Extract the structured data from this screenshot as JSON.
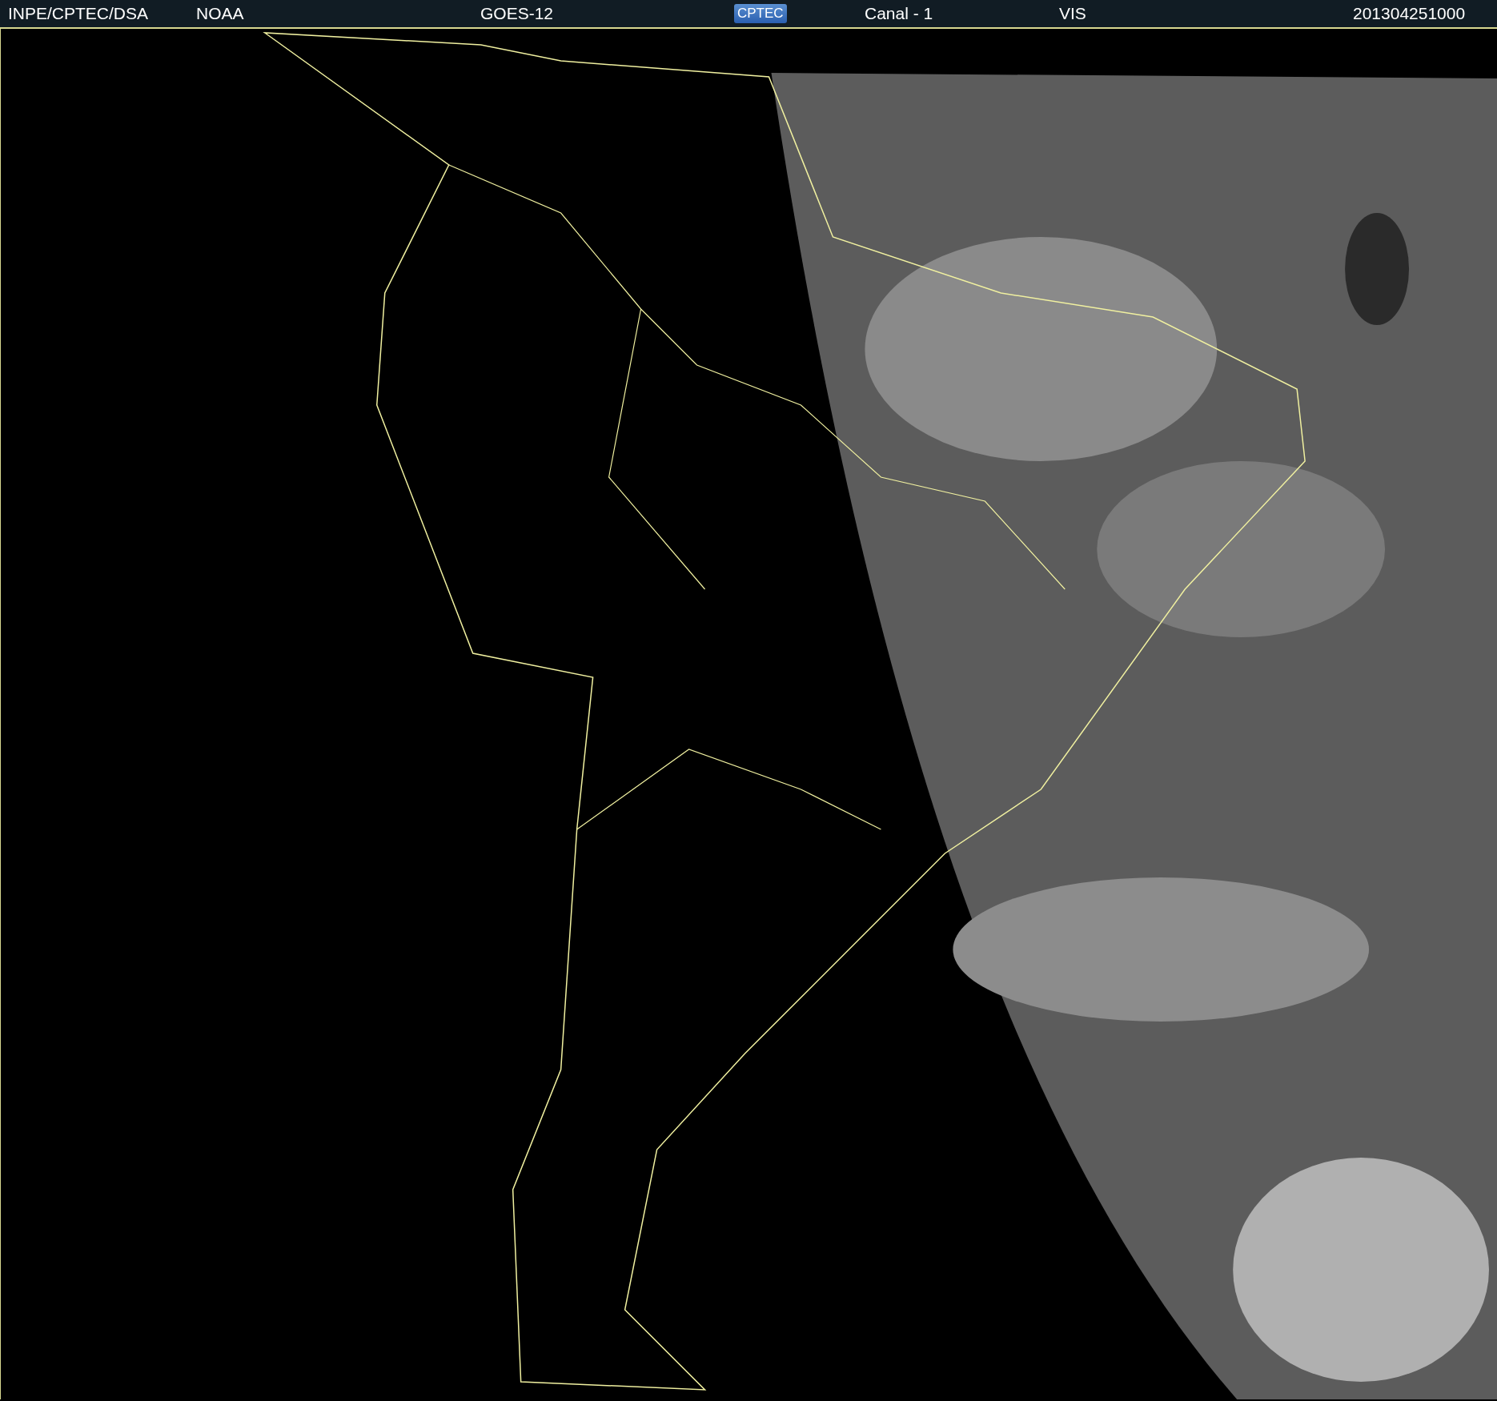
{
  "header": {
    "agency": "INPE/CPTEC/DSA",
    "source": "NOAA",
    "satellite": "GOES-12",
    "logo": "CPTEC",
    "channel": "Canal - 1",
    "band": "VIS",
    "timestamp": "201304251000"
  }
}
